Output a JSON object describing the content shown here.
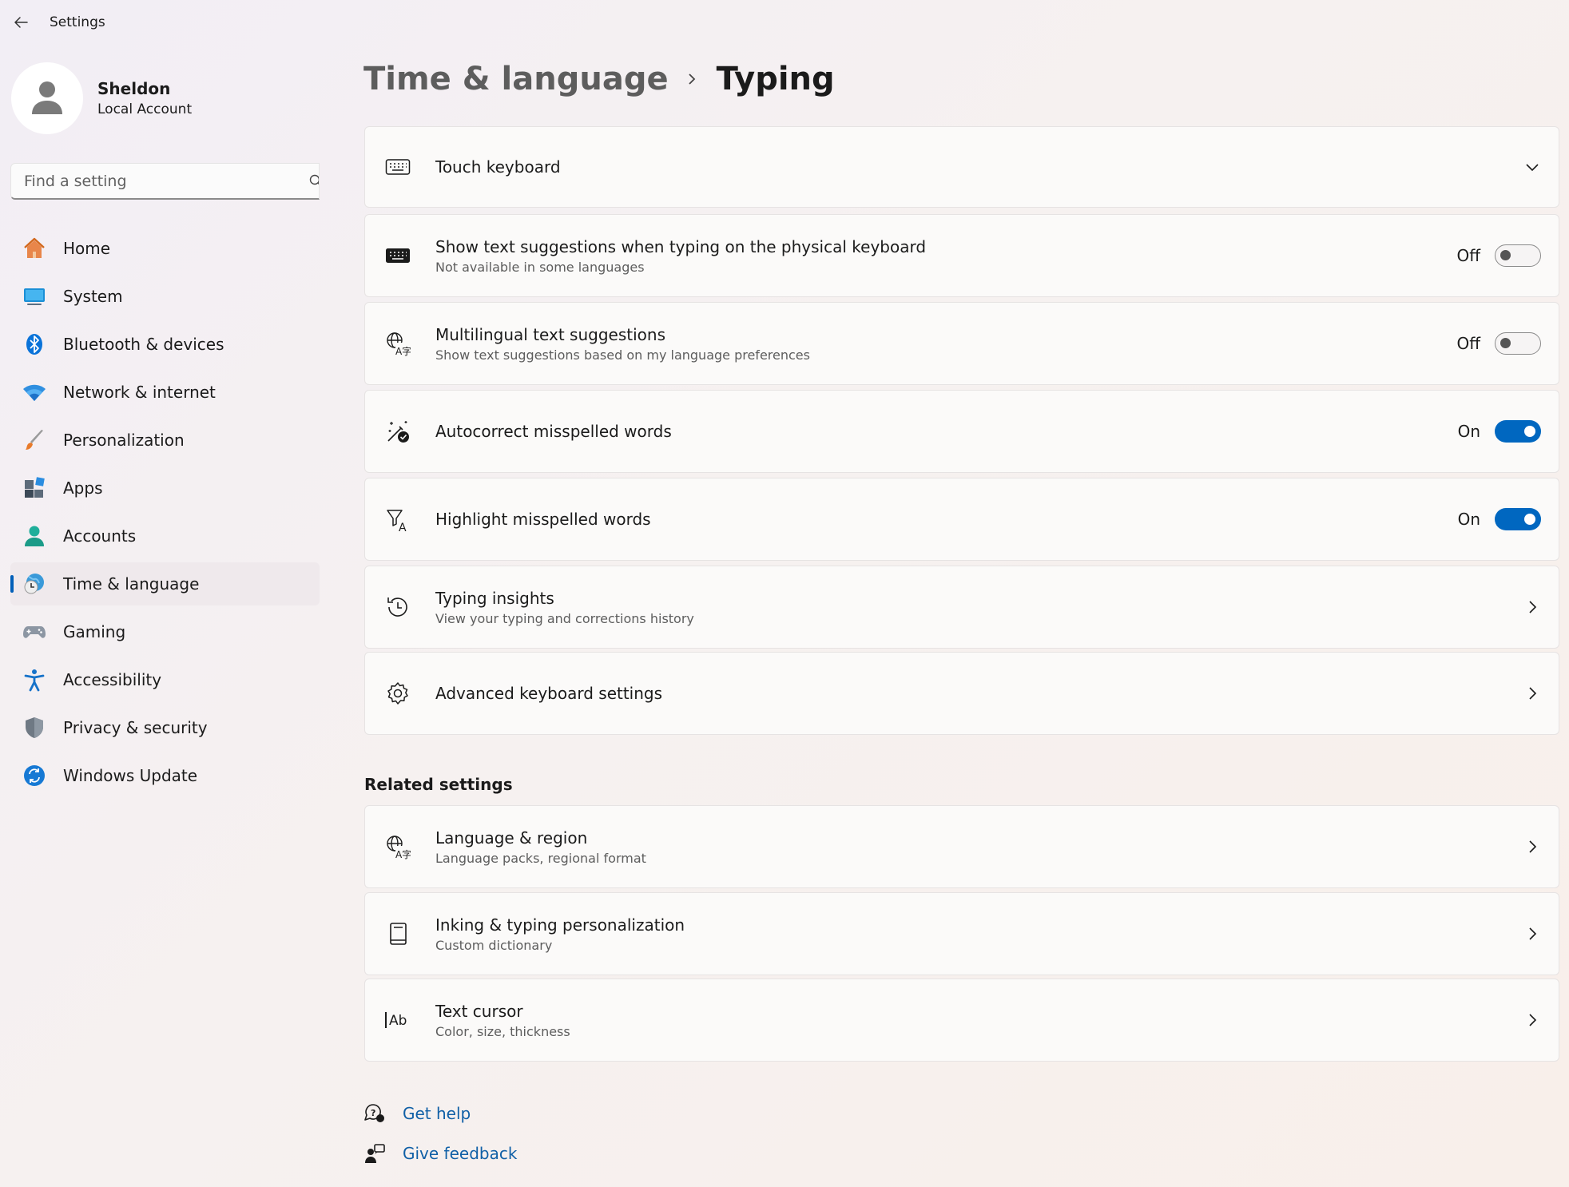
{
  "window": {
    "app_title": "Settings"
  },
  "profile": {
    "name": "Sheldon",
    "account_type": "Local Account"
  },
  "search": {
    "placeholder": "Find a setting"
  },
  "sidebar": {
    "items": [
      {
        "label": "Home",
        "icon": "home-icon"
      },
      {
        "label": "System",
        "icon": "system-icon"
      },
      {
        "label": "Bluetooth & devices",
        "icon": "bluetooth-icon"
      },
      {
        "label": "Network & internet",
        "icon": "wifi-icon"
      },
      {
        "label": "Personalization",
        "icon": "brush-icon"
      },
      {
        "label": "Apps",
        "icon": "apps-icon"
      },
      {
        "label": "Accounts",
        "icon": "accounts-icon"
      },
      {
        "label": "Time & language",
        "icon": "time-language-icon",
        "active": true
      },
      {
        "label": "Gaming",
        "icon": "gamepad-icon"
      },
      {
        "label": "Accessibility",
        "icon": "accessibility-icon"
      },
      {
        "label": "Privacy & security",
        "icon": "shield-icon"
      },
      {
        "label": "Windows Update",
        "icon": "update-icon"
      }
    ]
  },
  "breadcrumb": {
    "parent": "Time & language",
    "current": "Typing"
  },
  "settings": [
    {
      "title": "Touch keyboard",
      "icon": "touch-keyboard-icon",
      "control": "expand"
    },
    {
      "title": "Show text suggestions when typing on the physical keyboard",
      "subtitle": "Not available in some languages",
      "icon": "keyboard-icon",
      "control": "toggle",
      "state": "Off"
    },
    {
      "title": "Multilingual text suggestions",
      "subtitle": "Show text suggestions based on my language preferences",
      "icon": "language-icon",
      "control": "toggle",
      "state": "Off"
    },
    {
      "title": "Autocorrect misspelled words",
      "icon": "autocorrect-icon",
      "control": "toggle",
      "state": "On"
    },
    {
      "title": "Highlight misspelled words",
      "icon": "highlight-spelling-icon",
      "control": "toggle",
      "state": "On"
    },
    {
      "title": "Typing insights",
      "subtitle": "View your typing and corrections history",
      "icon": "history-icon",
      "control": "navigate"
    },
    {
      "title": "Advanced keyboard settings",
      "icon": "gear-icon",
      "control": "navigate"
    }
  ],
  "related": {
    "heading": "Related settings",
    "items": [
      {
        "title": "Language & region",
        "subtitle": "Language packs, regional format",
        "icon": "language-icon"
      },
      {
        "title": "Inking & typing personalization",
        "subtitle": "Custom dictionary",
        "icon": "dictionary-icon"
      },
      {
        "title": "Text cursor",
        "subtitle": "Color, size, thickness",
        "icon": "text-cursor-icon",
        "glyph": "Ab"
      }
    ]
  },
  "footer_links": [
    {
      "label": "Get help",
      "icon": "help-icon"
    },
    {
      "label": "Give feedback",
      "icon": "feedback-icon"
    }
  ],
  "colors": {
    "accent": "#0067c0",
    "link": "#0f5fa6",
    "active_nav_bg": "#efe9ec"
  }
}
